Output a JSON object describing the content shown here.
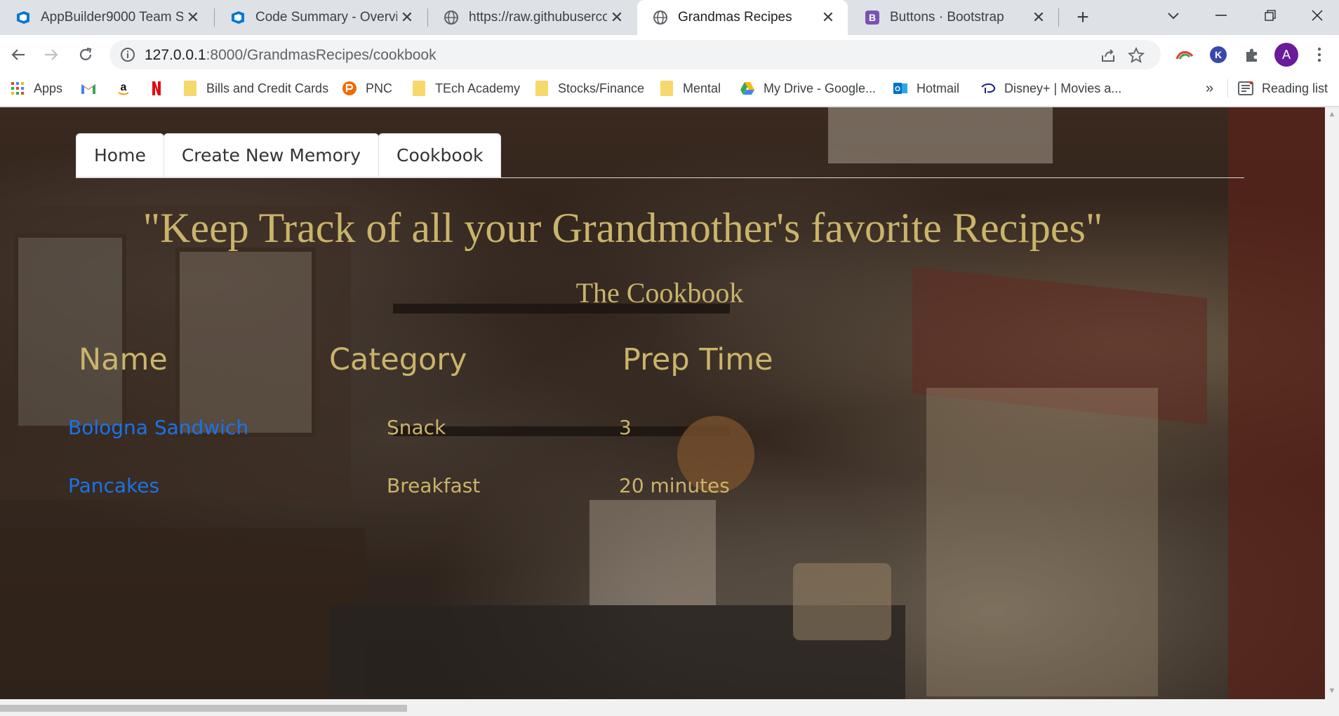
{
  "browser": {
    "tabs": [
      {
        "title": "AppBuilder9000 Team Sto",
        "icon": "azure-devops-icon"
      },
      {
        "title": "Code Summary - Overview",
        "icon": "azure-devops-icon"
      },
      {
        "title": "https://raw.githubuserco",
        "icon": "globe-icon"
      },
      {
        "title": "Grandmas Recipes",
        "icon": "globe-icon",
        "active": true
      },
      {
        "title": "Buttons · Bootstrap",
        "icon": "bootstrap-icon"
      }
    ],
    "url_host": "127.0.0.1",
    "url_path": ":8000/GrandmasRecipes/cookbook",
    "profile_initial": "A",
    "bookmarks": [
      {
        "label": "Apps",
        "icon": "apps-grid-icon"
      },
      {
        "label": "",
        "icon": "gmail-icon"
      },
      {
        "label": "",
        "icon": "amazon-icon"
      },
      {
        "label": "",
        "icon": "netflix-icon"
      },
      {
        "label": "Bills and Credit Cards",
        "icon": "folder-icon"
      },
      {
        "label": "PNC",
        "icon": "pnc-icon"
      },
      {
        "label": "TEch Academy",
        "icon": "folder-icon"
      },
      {
        "label": "Stocks/Finance",
        "icon": "folder-icon"
      },
      {
        "label": "Mental",
        "icon": "folder-icon"
      },
      {
        "label": "My Drive - Google...",
        "icon": "google-drive-icon"
      },
      {
        "label": "Hotmail",
        "icon": "outlook-icon"
      },
      {
        "label": "Disney+ | Movies a...",
        "icon": "disney-icon"
      }
    ],
    "bookmarks_overflow": "»",
    "reading_list": "Reading list"
  },
  "page": {
    "nav": [
      "Home",
      "Create New Memory",
      "Cookbook"
    ],
    "headline": "\"Keep Track of all your Grandmother's favorite Recipes\"",
    "subheading": "The Cookbook",
    "table": {
      "headers": [
        "Name",
        "Category",
        "Prep Time"
      ],
      "rows": [
        {
          "name": "Bologna Sandwich",
          "category": "Snack",
          "prep_time": "3"
        },
        {
          "name": "Pancakes",
          "category": "Breakfast",
          "prep_time": "20 minutes"
        }
      ]
    }
  },
  "colors": {
    "heading_gold": "#c9b46a",
    "link_blue": "#1a73e8"
  }
}
